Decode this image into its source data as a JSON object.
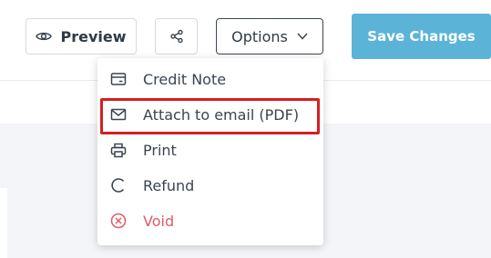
{
  "toolbar": {
    "preview_label": "Preview",
    "options_label": "Options",
    "save_label": "Save Changes",
    "save_color": "#5cb3d8"
  },
  "options_menu": {
    "items": [
      {
        "label": "Credit Note",
        "icon": "credit-note-icon"
      },
      {
        "label": "Attach to email (PDF)",
        "icon": "mail-icon",
        "highlighted": true
      },
      {
        "label": "Print",
        "icon": "printer-icon"
      },
      {
        "label": "Refund",
        "icon": "refund-icon"
      },
      {
        "label": "Void",
        "icon": "void-icon",
        "color": "#e05a66"
      }
    ],
    "highlight_color": "#d42020"
  }
}
